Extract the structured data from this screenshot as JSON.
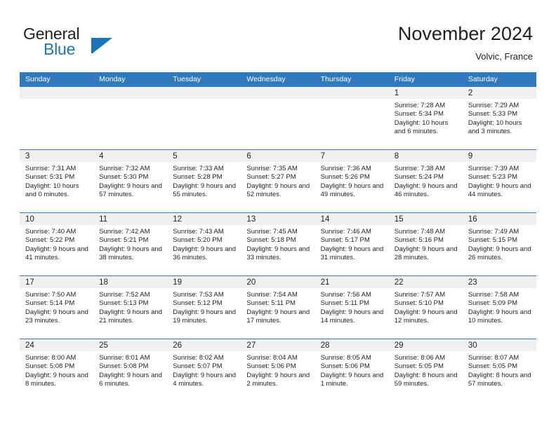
{
  "brand": {
    "line1": "General",
    "line2": "Blue",
    "flag_icon": "triangle-flag-icon",
    "accent_color": "#1b75bb"
  },
  "header": {
    "title": "November 2024",
    "location": "Volvic, France",
    "header_bg_color": "#3179be",
    "date_band_color": "#f0f0f0"
  },
  "weekday_headers": [
    "Sunday",
    "Monday",
    "Tuesday",
    "Wednesday",
    "Thursday",
    "Friday",
    "Saturday"
  ],
  "weeks": [
    [
      {
        "date": "",
        "empty": true
      },
      {
        "date": "",
        "empty": true
      },
      {
        "date": "",
        "empty": true
      },
      {
        "date": "",
        "empty": true
      },
      {
        "date": "",
        "empty": true
      },
      {
        "date": "1",
        "sunrise": "Sunrise: 7:28 AM",
        "sunset": "Sunset: 5:34 PM",
        "daylight": "Daylight: 10 hours and 6 minutes."
      },
      {
        "date": "2",
        "sunrise": "Sunrise: 7:29 AM",
        "sunset": "Sunset: 5:33 PM",
        "daylight": "Daylight: 10 hours and 3 minutes."
      }
    ],
    [
      {
        "date": "3",
        "sunrise": "Sunrise: 7:31 AM",
        "sunset": "Sunset: 5:31 PM",
        "daylight": "Daylight: 10 hours and 0 minutes."
      },
      {
        "date": "4",
        "sunrise": "Sunrise: 7:32 AM",
        "sunset": "Sunset: 5:30 PM",
        "daylight": "Daylight: 9 hours and 57 minutes."
      },
      {
        "date": "5",
        "sunrise": "Sunrise: 7:33 AM",
        "sunset": "Sunset: 5:28 PM",
        "daylight": "Daylight: 9 hours and 55 minutes."
      },
      {
        "date": "6",
        "sunrise": "Sunrise: 7:35 AM",
        "sunset": "Sunset: 5:27 PM",
        "daylight": "Daylight: 9 hours and 52 minutes."
      },
      {
        "date": "7",
        "sunrise": "Sunrise: 7:36 AM",
        "sunset": "Sunset: 5:26 PM",
        "daylight": "Daylight: 9 hours and 49 minutes."
      },
      {
        "date": "8",
        "sunrise": "Sunrise: 7:38 AM",
        "sunset": "Sunset: 5:24 PM",
        "daylight": "Daylight: 9 hours and 46 minutes."
      },
      {
        "date": "9",
        "sunrise": "Sunrise: 7:39 AM",
        "sunset": "Sunset: 5:23 PM",
        "daylight": "Daylight: 9 hours and 44 minutes."
      }
    ],
    [
      {
        "date": "10",
        "sunrise": "Sunrise: 7:40 AM",
        "sunset": "Sunset: 5:22 PM",
        "daylight": "Daylight: 9 hours and 41 minutes."
      },
      {
        "date": "11",
        "sunrise": "Sunrise: 7:42 AM",
        "sunset": "Sunset: 5:21 PM",
        "daylight": "Daylight: 9 hours and 38 minutes."
      },
      {
        "date": "12",
        "sunrise": "Sunrise: 7:43 AM",
        "sunset": "Sunset: 5:20 PM",
        "daylight": "Daylight: 9 hours and 36 minutes."
      },
      {
        "date": "13",
        "sunrise": "Sunrise: 7:45 AM",
        "sunset": "Sunset: 5:18 PM",
        "daylight": "Daylight: 9 hours and 33 minutes."
      },
      {
        "date": "14",
        "sunrise": "Sunrise: 7:46 AM",
        "sunset": "Sunset: 5:17 PM",
        "daylight": "Daylight: 9 hours and 31 minutes."
      },
      {
        "date": "15",
        "sunrise": "Sunrise: 7:48 AM",
        "sunset": "Sunset: 5:16 PM",
        "daylight": "Daylight: 9 hours and 28 minutes."
      },
      {
        "date": "16",
        "sunrise": "Sunrise: 7:49 AM",
        "sunset": "Sunset: 5:15 PM",
        "daylight": "Daylight: 9 hours and 26 minutes."
      }
    ],
    [
      {
        "date": "17",
        "sunrise": "Sunrise: 7:50 AM",
        "sunset": "Sunset: 5:14 PM",
        "daylight": "Daylight: 9 hours and 23 minutes."
      },
      {
        "date": "18",
        "sunrise": "Sunrise: 7:52 AM",
        "sunset": "Sunset: 5:13 PM",
        "daylight": "Daylight: 9 hours and 21 minutes."
      },
      {
        "date": "19",
        "sunrise": "Sunrise: 7:53 AM",
        "sunset": "Sunset: 5:12 PM",
        "daylight": "Daylight: 9 hours and 19 minutes."
      },
      {
        "date": "20",
        "sunrise": "Sunrise: 7:54 AM",
        "sunset": "Sunset: 5:11 PM",
        "daylight": "Daylight: 9 hours and 17 minutes."
      },
      {
        "date": "21",
        "sunrise": "Sunrise: 7:56 AM",
        "sunset": "Sunset: 5:11 PM",
        "daylight": "Daylight: 9 hours and 14 minutes."
      },
      {
        "date": "22",
        "sunrise": "Sunrise: 7:57 AM",
        "sunset": "Sunset: 5:10 PM",
        "daylight": "Daylight: 9 hours and 12 minutes."
      },
      {
        "date": "23",
        "sunrise": "Sunrise: 7:58 AM",
        "sunset": "Sunset: 5:09 PM",
        "daylight": "Daylight: 9 hours and 10 minutes."
      }
    ],
    [
      {
        "date": "24",
        "sunrise": "Sunrise: 8:00 AM",
        "sunset": "Sunset: 5:08 PM",
        "daylight": "Daylight: 9 hours and 8 minutes."
      },
      {
        "date": "25",
        "sunrise": "Sunrise: 8:01 AM",
        "sunset": "Sunset: 5:08 PM",
        "daylight": "Daylight: 9 hours and 6 minutes."
      },
      {
        "date": "26",
        "sunrise": "Sunrise: 8:02 AM",
        "sunset": "Sunset: 5:07 PM",
        "daylight": "Daylight: 9 hours and 4 minutes."
      },
      {
        "date": "27",
        "sunrise": "Sunrise: 8:04 AM",
        "sunset": "Sunset: 5:06 PM",
        "daylight": "Daylight: 9 hours and 2 minutes."
      },
      {
        "date": "28",
        "sunrise": "Sunrise: 8:05 AM",
        "sunset": "Sunset: 5:06 PM",
        "daylight": "Daylight: 9 hours and 1 minute."
      },
      {
        "date": "29",
        "sunrise": "Sunrise: 8:06 AM",
        "sunset": "Sunset: 5:05 PM",
        "daylight": "Daylight: 8 hours and 59 minutes."
      },
      {
        "date": "30",
        "sunrise": "Sunrise: 8:07 AM",
        "sunset": "Sunset: 5:05 PM",
        "daylight": "Daylight: 8 hours and 57 minutes."
      }
    ]
  ]
}
